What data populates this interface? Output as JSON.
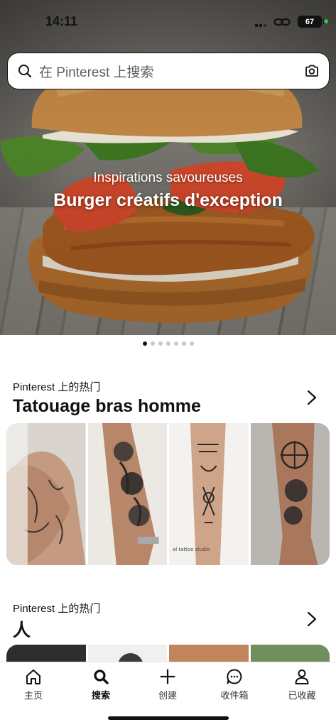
{
  "status_bar": {
    "time": "14:11",
    "battery": "67"
  },
  "search": {
    "placeholder": "在 Pinterest 上搜索"
  },
  "hero": {
    "subtitle": "Inspirations savoureuses",
    "title": "Burger créatifs d'exception",
    "carousel_pages": 7,
    "carousel_active": 0
  },
  "sections": [
    {
      "kicker": "Pinterest 上的热门",
      "title": "Tatouage bras homme"
    },
    {
      "kicker": "Pinterest 上的热门",
      "title": "人"
    }
  ],
  "tattoo_caption": "al tattoo studio",
  "tabs": [
    {
      "label": "主页",
      "icon": "home-icon"
    },
    {
      "label": "搜索",
      "icon": "search-icon",
      "active": true
    },
    {
      "label": "创建",
      "icon": "plus-icon"
    },
    {
      "label": "收件箱",
      "icon": "chat-icon"
    },
    {
      "label": "已收藏",
      "icon": "profile-icon"
    }
  ],
  "colors": {
    "accent": "#111111",
    "placeholder": "#5f5f5f",
    "status_green": "#2ecc40"
  }
}
